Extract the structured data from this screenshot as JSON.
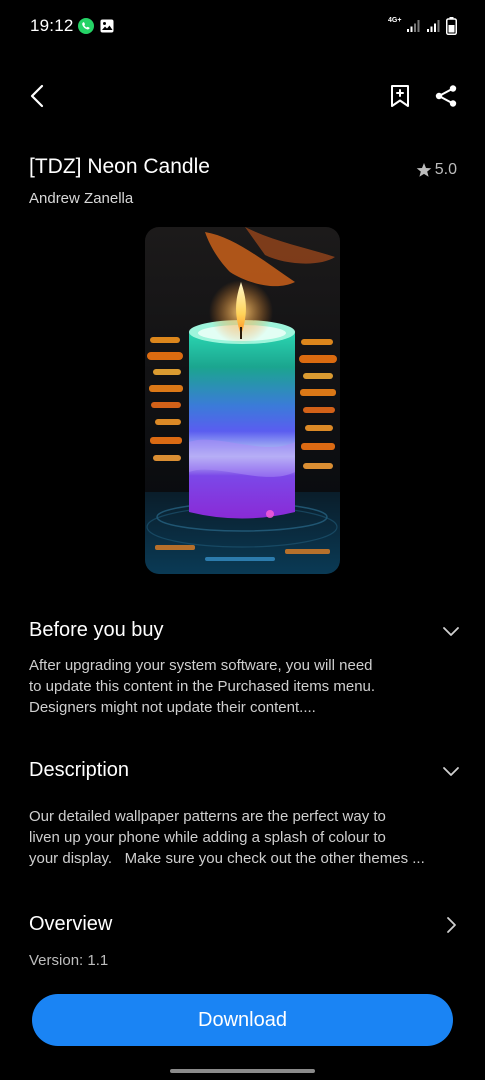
{
  "status_bar": {
    "time": "19:12",
    "network_label": "4G+",
    "icons": [
      "whatsapp-icon",
      "gallery-icon",
      "signal-icon",
      "signal-icon",
      "battery-icon"
    ]
  },
  "toolbar": {
    "back_icon": "chevron-left-icon",
    "bookmark_icon": "bookmark-add-icon",
    "share_icon": "share-icon"
  },
  "theme": {
    "title": "[TDZ] Neon Candle",
    "author": "Andrew Zanella",
    "rating": "5.0"
  },
  "sections": {
    "before_you_buy": {
      "title": "Before you buy",
      "lines": [
        "After upgrading your system software, you will need",
        "to update this content in the Purchased items menu.",
        "Designers might not update their content...."
      ]
    },
    "description": {
      "title": "Description",
      "lines": [
        "Our detailed wallpaper patterns are the perfect way to",
        "liven up your phone while adding a splash of colour to",
        "your display.   Make sure you check out the other themes ..."
      ]
    },
    "overview": {
      "title": "Overview",
      "version": "Version: 1.1"
    }
  },
  "download": {
    "label": "Download"
  },
  "colors": {
    "background": "#000000",
    "accent": "#1a84f4",
    "text_primary": "#ffffff",
    "text_secondary": "#cfcfcf"
  }
}
